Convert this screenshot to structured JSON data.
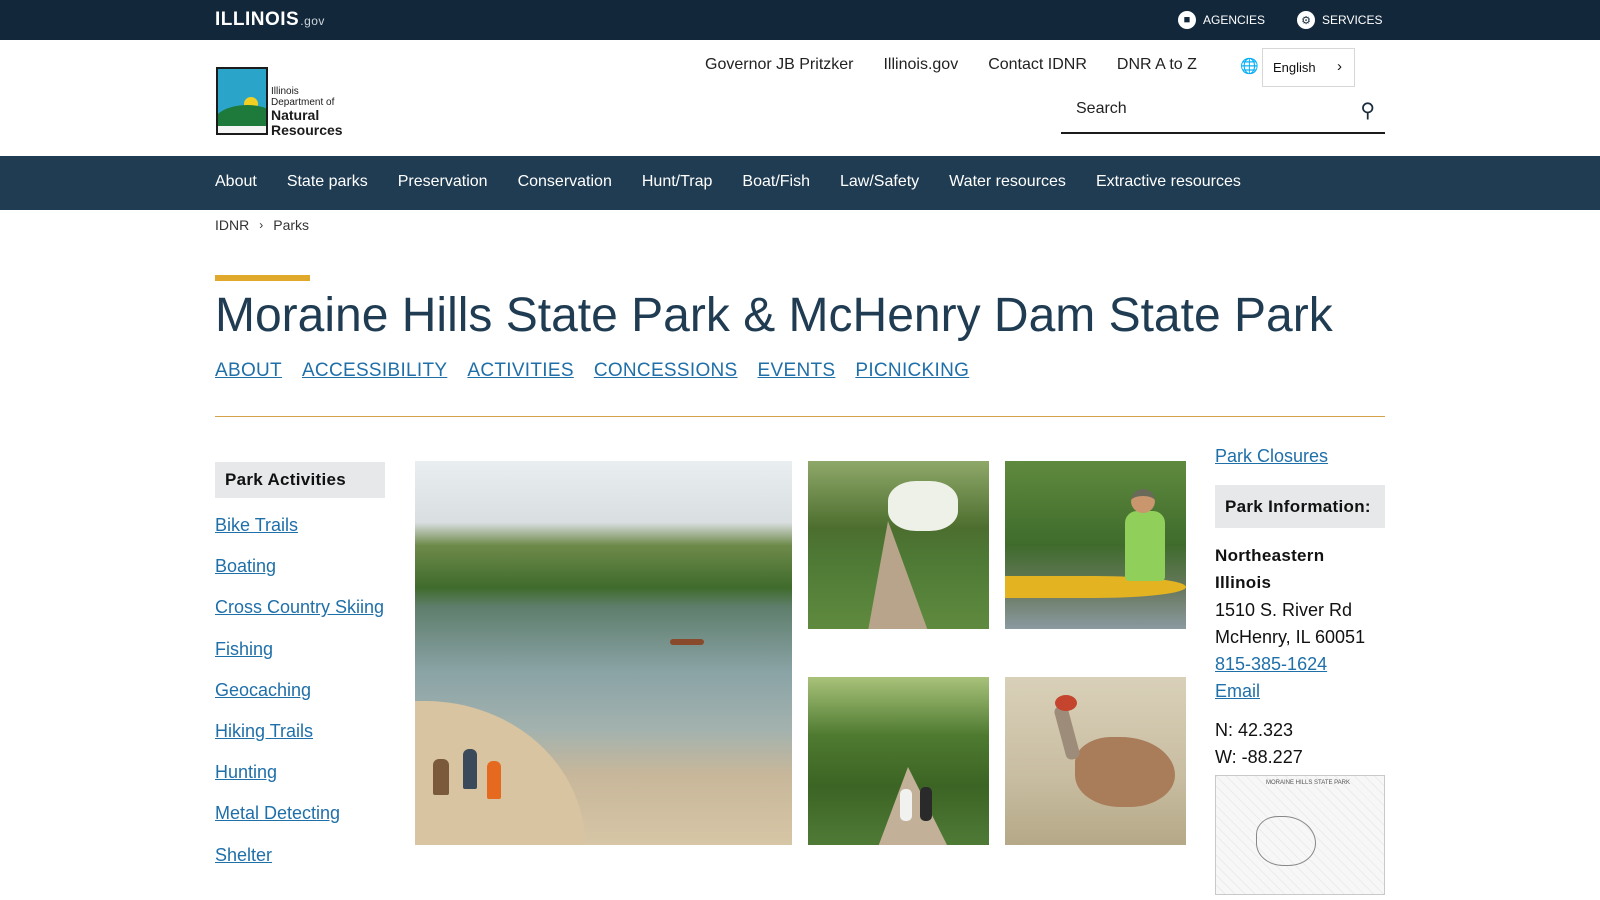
{
  "topbar": {
    "wordmark": "ILLINOIS",
    "wordmark_suffix": ".gov",
    "agencies_label": "AGENCIES",
    "services_label": "SERVICES"
  },
  "logo": {
    "line1": "Illinois",
    "line2": "Department of",
    "line3": "Natural",
    "line4": "Resources"
  },
  "util_nav": {
    "items": [
      "Governor JB Pritzker",
      "Illinois.gov",
      "Contact IDNR",
      "DNR A to Z"
    ],
    "language": "English"
  },
  "search": {
    "placeholder": "Search"
  },
  "main_nav": {
    "items": [
      "About",
      "State parks",
      "Preservation",
      "Conservation",
      "Hunt/Trap",
      "Boat/Fish",
      "Law/Safety",
      "Water resources",
      "Extractive resources"
    ]
  },
  "breadcrumb": {
    "items": [
      "IDNR",
      "Parks"
    ]
  },
  "page": {
    "title": "Moraine Hills State Park & McHenry Dam State Park",
    "subnav": [
      "ABOUT",
      "ACCESSIBILITY",
      "ACTIVITIES",
      "CONCESSIONS",
      "EVENTS",
      "PICNICKING"
    ]
  },
  "sidebar": {
    "heading": "Park Activities",
    "items": [
      "Bike Trails",
      "Boating",
      "Cross Country Skiing",
      "Fishing",
      "Geocaching",
      "Hiking Trails",
      "Hunting",
      "Metal Detecting",
      "Shelter"
    ]
  },
  "right_rail": {
    "closures_link": "Park Closures",
    "info_heading": "Park Information:",
    "region": "Northeastern Illinois",
    "address1": "1510 S. River Rd",
    "address2": "McHenry, IL 60051",
    "phone": "815-385-1624",
    "email": "Email",
    "lat": "N: 42.323",
    "lon": "W: -88.227",
    "map_title": "MORAINE HILLS STATE PARK"
  },
  "colors": {
    "topbar": "#12273a",
    "main_nav": "#1f3c52",
    "accent": "#e0a92b",
    "link": "#1f6fa9",
    "title": "#1f3c52"
  }
}
